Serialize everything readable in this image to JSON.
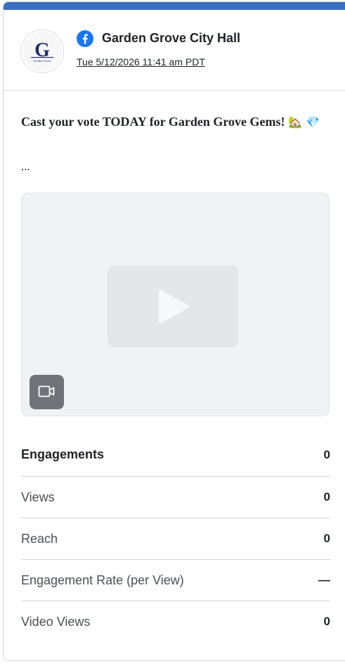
{
  "post": {
    "account_name": "Garden Grove City Hall",
    "network_icon": "facebook-icon",
    "timestamp": "Tue 5/12/2026 11:41 am PDT",
    "avatar": {
      "logo_letter": "G",
      "logo_text": "Garden Grove"
    },
    "text": "Cast your vote TODAY for Garden Grove Gems!",
    "text_emojis": "🏡 💎",
    "more": "...",
    "media_type_icon": "video-camera-icon"
  },
  "metrics": [
    {
      "label": "Engagements",
      "value": "0"
    },
    {
      "label": "Views",
      "value": "0"
    },
    {
      "label": "Reach",
      "value": "0"
    },
    {
      "label": "Engagement Rate (per View)",
      "value": "—"
    },
    {
      "label": "Video Views",
      "value": "0"
    }
  ],
  "colors": {
    "accent_bar": "#3a6fc1",
    "facebook_blue": "#1877f2",
    "logo_navy": "#1f2f6b",
    "badge_gray": "#707478"
  }
}
